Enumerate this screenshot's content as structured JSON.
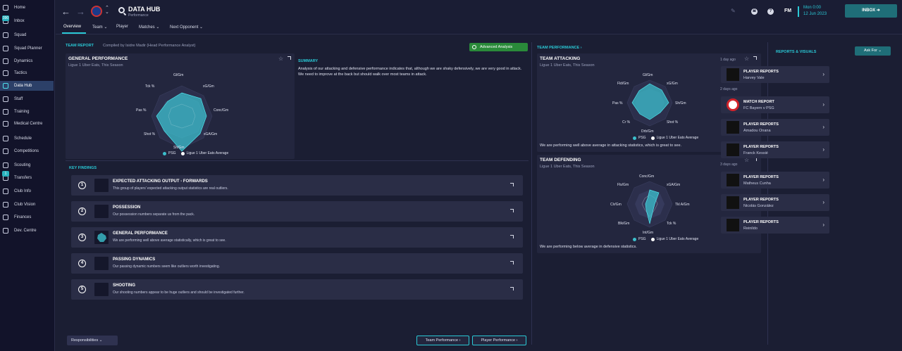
{
  "sidebar": {
    "items": [
      {
        "label": "Home"
      },
      {
        "label": "Inbox",
        "badge": "390"
      },
      {
        "label": "Squad"
      },
      {
        "label": "Squad Planner"
      },
      {
        "label": "Dynamics"
      },
      {
        "label": "Tactics"
      },
      {
        "label": "Data Hub"
      },
      {
        "label": "Staff"
      },
      {
        "label": "Training"
      },
      {
        "label": "Medical Centre"
      },
      {
        "label": "Schedule"
      },
      {
        "label": "Competitions"
      },
      {
        "label": "Scouting"
      },
      {
        "label": "Transfers",
        "badge": "1"
      },
      {
        "label": "Club Info"
      },
      {
        "label": "Club Vision"
      },
      {
        "label": "Finances"
      },
      {
        "label": "Dev. Centre"
      }
    ]
  },
  "header": {
    "title": "DATA HUB",
    "subtitle": "Performance",
    "tabs": [
      "Overview",
      "Team ⌄",
      "Player",
      "Matches ⌄",
      "Next Opponent ⌄"
    ],
    "fm_label": "FM",
    "help_label": "?",
    "date_line1": "Mon 0:00",
    "date_line2": "12 Jun 2023",
    "inbox_label": "INBOX ➜"
  },
  "team_report": {
    "header": "TEAM REPORT",
    "compiled_by": "Compiled by Isidre Madir (Head Performance Analyst)",
    "advanced_analysis": "Advanced Analysis",
    "card_title": "GENERAL PERFORMANCE",
    "card_sub": "Ligue 1 Uber Eats, This Season",
    "radar_labels": [
      "Gl/Gm",
      "xG/Gm",
      "Conc/Gm",
      "xGA/Gm",
      "Sh/Gm",
      "Shot %",
      "Pas %",
      "Tck %"
    ],
    "legend_team": "PSG",
    "legend_avg": "Ligue 1 Uber Eats Average",
    "summary_title": "SUMMARY",
    "summary_text": "Analysis of our attacking and defensive performance indicates that, although we are shaky defensively, we are very good in attack. We need to improve at the back but should walk over most teams in attack."
  },
  "key_findings": {
    "header": "KEY FINDINGS",
    "items": [
      {
        "num": "1",
        "title": "EXPECTED ATTACKING OUTPUT - FORWARDS",
        "desc": "This group of players' expected attacking output statistics are real outliers."
      },
      {
        "num": "2",
        "title": "POSSESSION",
        "desc": "Our possession numbers separate us from the pack."
      },
      {
        "num": "3",
        "title": "GENERAL PERFORMANCE",
        "desc": "We are performing well above average statistically, which is great to see."
      },
      {
        "num": "4",
        "title": "PASSING DYNAMICS",
        "desc": "Our passing dynamic numbers seem like outliers worth investigating."
      },
      {
        "num": "5",
        "title": "SHOOTING",
        "desc": "Our shooting numbers appear to be huge outliers and should be investigated further."
      }
    ]
  },
  "team_performance": {
    "header": "TEAM PERFORMANCE ›",
    "attacking": {
      "title": "TEAM ATTACKING",
      "sub": "Ligue 1 Uber Eats, This Season",
      "labels": [
        "Gl/Gm",
        "xG/Gm",
        "Sh/Gm",
        "Shot %",
        "Drb/Gm",
        "Cr %",
        "Pas %",
        "Fld/Gm"
      ],
      "footer": "We are performing well above average in attacking statistics, which is great to see."
    },
    "defending": {
      "title": "TEAM DEFENDING",
      "sub": "Ligue 1 Uber Eats, This Season",
      "labels": [
        "Conc/Gm",
        "xGA/Gm",
        "Tkl A/Gm",
        "Tck %",
        "Int/Gm",
        "Blk/Gm",
        "Clr/Gm",
        "Fls/Gm"
      ],
      "footer": "We are performing below average in defensive statistics."
    },
    "legend_team": "PSG",
    "legend_avg": "Ligue 1 Uber Eats Average"
  },
  "reports": {
    "header": "REPORTS & VISUALS",
    "ask_for": "Ask For ⌄",
    "days": [
      "1 day ago",
      "2 days ago",
      "3 days ago"
    ],
    "items": [
      {
        "title": "PLAYER REPORTS",
        "name": "Harvey Vale"
      },
      {
        "title": "MATCH REPORT",
        "name": "FC Bayern v PSG"
      },
      {
        "title": "PLAYER REPORTS",
        "name": "Amadou Onana"
      },
      {
        "title": "PLAYER REPORTS",
        "name": "Franck Kessié"
      },
      {
        "title": "PLAYER REPORTS",
        "name": "Matheus Cunha"
      },
      {
        "title": "PLAYER REPORTS",
        "name": "Nicolás González"
      },
      {
        "title": "PLAYER REPORTS",
        "name": "Reinildo"
      }
    ]
  },
  "footer": {
    "responsibilities": "Responsibilities ⌄",
    "team_performance_btn": "Team Performance ›",
    "player_performance_btn": "Player Performance ›"
  },
  "colors": {
    "accent": "#2ac9d6",
    "team_fill": "#3bbfcc",
    "avg": "#ffffff",
    "bg": "#1b1e33"
  }
}
